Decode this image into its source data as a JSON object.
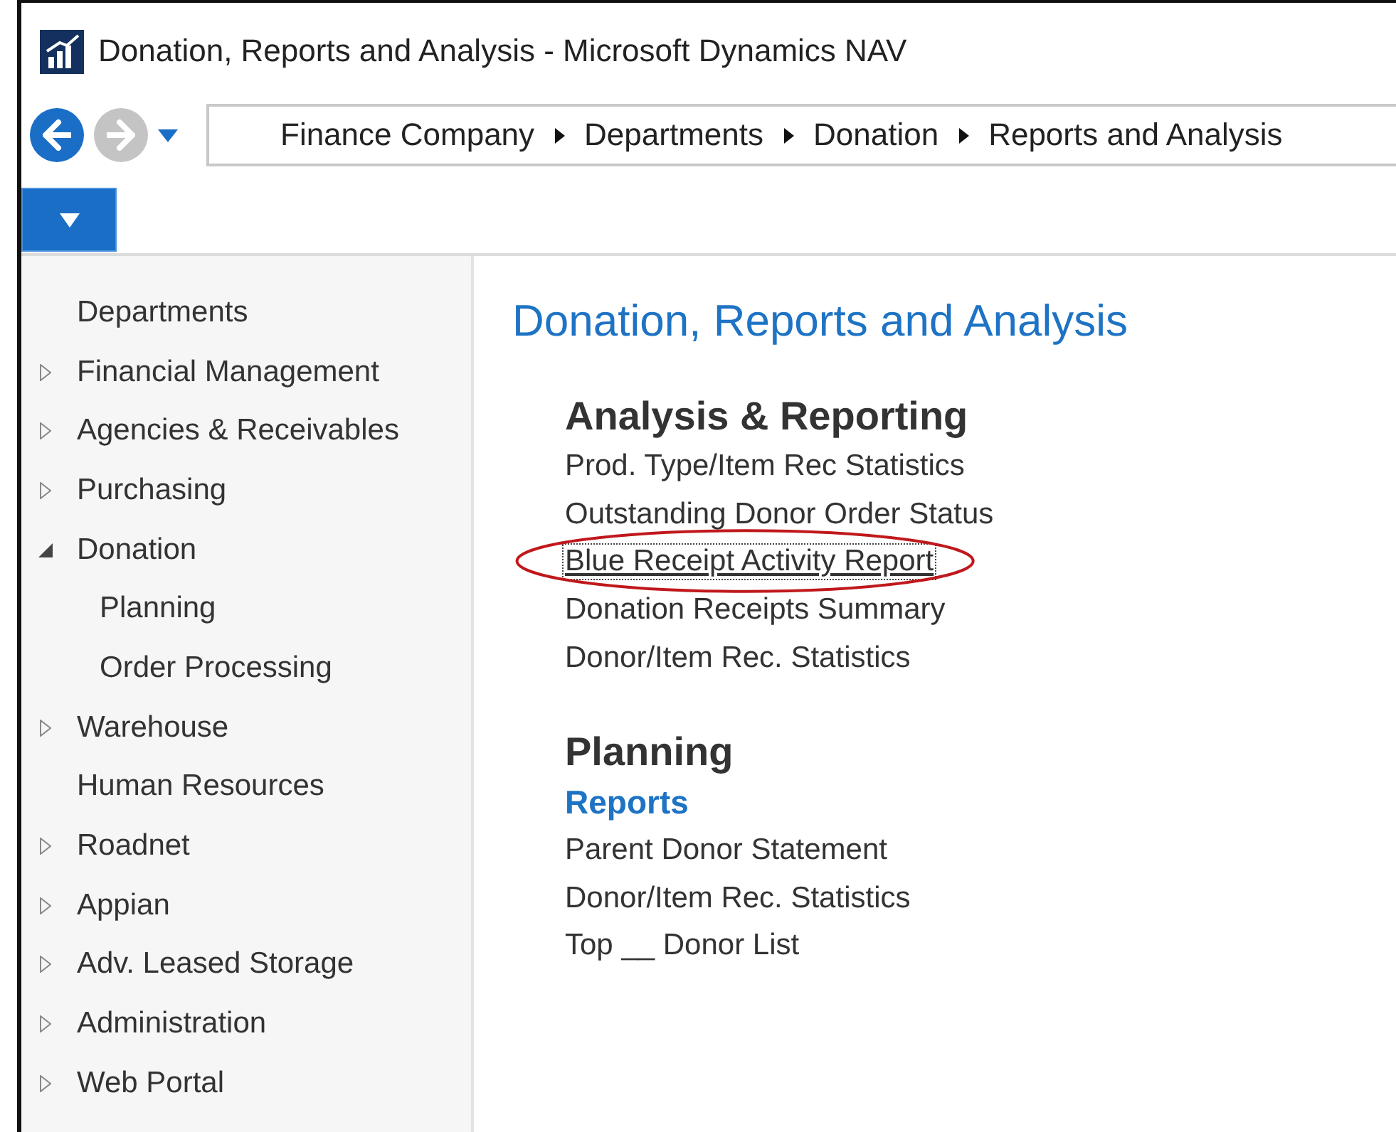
{
  "window": {
    "title": "Donation, Reports and Analysis - Microsoft Dynamics NAV"
  },
  "navigation": {
    "back_enabled": true,
    "forward_enabled": false
  },
  "breadcrumb": [
    "Finance Company",
    "Departments",
    "Donation",
    "Reports and Analysis"
  ],
  "sidebar": {
    "items": [
      {
        "label": "Departments"
      },
      {
        "label": "Financial Management",
        "expanded": false
      },
      {
        "label": "Agencies & Receivables",
        "expanded": false
      },
      {
        "label": "Purchasing",
        "expanded": false
      },
      {
        "label": "Donation",
        "expanded": true,
        "children": [
          {
            "label": "Planning"
          },
          {
            "label": "Order Processing"
          }
        ]
      },
      {
        "label": "Warehouse",
        "expanded": false
      },
      {
        "label": "Human Resources"
      },
      {
        "label": "Roadnet",
        "expanded": false
      },
      {
        "label": "Appian",
        "expanded": false
      },
      {
        "label": "Adv. Leased Storage",
        "expanded": false
      },
      {
        "label": "Administration",
        "expanded": false
      },
      {
        "label": "Web Portal",
        "expanded": false
      }
    ]
  },
  "page": {
    "title": "Donation, Reports and Analysis",
    "groups": [
      {
        "heading": "Analysis & Reporting",
        "items": [
          {
            "kind": "link",
            "label": "Prod. Type/Item Rec Statistics",
            "focused": false,
            "circled": false
          },
          {
            "kind": "link",
            "label": "Outstanding Donor Order Status",
            "focused": false,
            "circled": false
          },
          {
            "kind": "link",
            "label": "Blue Receipt Activity Report",
            "focused": true,
            "circled": true
          },
          {
            "kind": "link",
            "label": "Donation Receipts Summary",
            "focused": false,
            "circled": false
          },
          {
            "kind": "link",
            "label": "Donor/Item Rec. Statistics",
            "focused": false,
            "circled": false
          }
        ]
      },
      {
        "heading": "Planning",
        "items": [
          {
            "kind": "subheading",
            "label": "Reports"
          },
          {
            "kind": "link",
            "label": "Parent Donor Statement",
            "focused": false,
            "circled": false
          },
          {
            "kind": "link",
            "label": "Donor/Item Rec. Statistics",
            "focused": false,
            "circled": false
          },
          {
            "kind": "link",
            "label": "Top __ Donor List",
            "focused": false,
            "circled": false
          }
        ]
      }
    ]
  }
}
